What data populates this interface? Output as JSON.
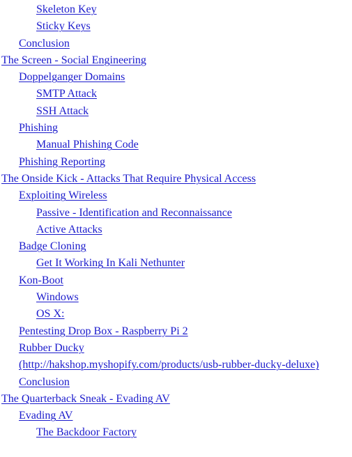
{
  "toc": {
    "entries": [
      {
        "text": "Skeleton Key",
        "level": 3
      },
      {
        "text": "Sticky Keys",
        "level": 3
      },
      {
        "text": "Conclusion",
        "level": 2
      },
      {
        "text": "The Screen - Social Engineering",
        "level": 1
      },
      {
        "text": "Doppelganger Domains",
        "level": 2
      },
      {
        "text": "SMTP Attack",
        "level": 3
      },
      {
        "text": "SSH Attack",
        "level": 3
      },
      {
        "text": "Phishing",
        "level": 2
      },
      {
        "text": "Manual Phishing Code",
        "level": 3
      },
      {
        "text": "Phishing Reporting",
        "level": 2
      },
      {
        "text": "The Onside Kick - Attacks That Require Physical Access",
        "level": 1
      },
      {
        "text": "Exploiting Wireless",
        "level": 2
      },
      {
        "text": "Passive - Identification and Reconnaissance",
        "level": 3
      },
      {
        "text": "Active Attacks",
        "level": 3
      },
      {
        "text": "Badge Cloning",
        "level": 2
      },
      {
        "text": "Get It Working In Kali Nethunter",
        "level": 3
      },
      {
        "text": "Kon-Boot",
        "level": 2
      },
      {
        "text": "Windows",
        "level": 3
      },
      {
        "text": "OS X:",
        "level": 3
      },
      {
        "text": "Pentesting Drop Box - Raspberry Pi 2",
        "level": 2
      },
      {
        "text": "Rubber Ducky",
        "level": 2
      },
      {
        "text": "(http://hakshop.myshopify.com/products/usb-rubber-ducky-deluxe)",
        "level": 2
      },
      {
        "text": "Conclusion",
        "level": 2
      },
      {
        "text": "The Quarterback Sneak - Evading AV",
        "level": 1
      },
      {
        "text": "Evading AV",
        "level": 2
      },
      {
        "text": "The Backdoor Factory",
        "level": 3
      }
    ]
  },
  "colors": {
    "link": "#1a1acc",
    "background": "#ffffff"
  }
}
